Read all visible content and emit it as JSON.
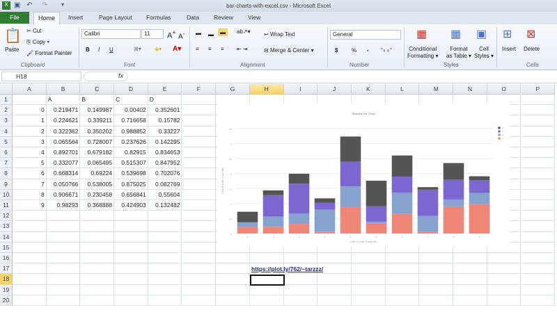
{
  "window": {
    "title": "bar-charts-with-excel.csv - Microsoft Excel"
  },
  "tabs": [
    "File",
    "Home",
    "Insert",
    "Page Layout",
    "Formulas",
    "Data",
    "Review",
    "View"
  ],
  "ribbon": {
    "clipboard": {
      "paste": "Paste",
      "cut": "Cut",
      "copy": "Copy",
      "format_painter": "Format Painter",
      "label": "Clipboard"
    },
    "font": {
      "name": "Calibri",
      "size": "11",
      "label": "Font",
      "bold": "B",
      "italic": "I",
      "underline": "U"
    },
    "alignment": {
      "wrap": "Wrap Text",
      "merge": "Merge & Center",
      "label": "Alignment"
    },
    "number": {
      "format": "General",
      "currency": "$",
      "percent": "%",
      "comma": ",",
      "label": "Number"
    },
    "styles": {
      "conditional": [
        "Conditional",
        "Formatting"
      ],
      "table": [
        "Format",
        "as Table"
      ],
      "cell": [
        "Cell",
        "Styles"
      ],
      "label": "Styles"
    },
    "cells": {
      "insert": "Insert",
      "delete": "Delete",
      "label": "Cells"
    }
  },
  "formula_bar": {
    "name_box": "H18",
    "fx": "fx",
    "value": ""
  },
  "sheet": {
    "columns": [
      "A",
      "B",
      "C",
      "D",
      "E",
      "F",
      "G",
      "H",
      "I",
      "J",
      "K",
      "L",
      "M",
      "N",
      "O",
      "P"
    ],
    "selected_column": "H",
    "selected_row": 18,
    "rows": 20,
    "header_row": [
      "",
      "A",
      "B",
      "C",
      "D"
    ],
    "data": [
      [
        "0",
        "0.219471",
        "0.149987",
        "0.00402",
        "0.352601"
      ],
      [
        "1",
        "0.224621",
        "0.339211",
        "0.716658",
        "0.15782"
      ],
      [
        "2",
        "0.322362",
        "0.350202",
        "0.988852",
        "0.33227"
      ],
      [
        "3",
        "0.065564",
        "0.728007",
        "0.237626",
        "0.142295"
      ],
      [
        "4",
        "0.892701",
        "0.679182",
        "0.82915",
        "0.834653"
      ],
      [
        "5",
        "0.332077",
        "0.065495",
        "0.515307",
        "0.847952"
      ],
      [
        "6",
        "0.668314",
        "0.69224",
        "0.539698",
        "0.702076"
      ],
      [
        "7",
        "0.050766",
        "0.538005",
        "0.875025",
        "0.082769"
      ],
      [
        "8",
        "0.906671",
        "0.230458",
        "0.656841",
        "0.55604"
      ],
      [
        "9",
        "0.98293",
        "0.368888",
        "0.424903",
        "0.132482"
      ]
    ],
    "link": "https://plot.ly/762/~tarzzz/"
  },
  "chart_data": {
    "type": "bar",
    "stacked": true,
    "title": "Stacked Bar Chart",
    "xlabel": "Click to enter X axis title",
    "ylabel": "Click to enter Y axis title",
    "categories": [
      "0",
      "1",
      "2",
      "3",
      "4",
      "5",
      "6",
      "7",
      "8",
      "9"
    ],
    "ylim": [
      0,
      3.5
    ],
    "grid": true,
    "legend": "top-right",
    "series": [
      {
        "name": "A",
        "color": "#ef8677",
        "values": [
          0.219471,
          0.224621,
          0.322362,
          0.065564,
          0.892701,
          0.332077,
          0.668314,
          0.050766,
          0.906671,
          0.98293
        ]
      },
      {
        "name": "B",
        "color": "#86a3cf",
        "values": [
          0.149987,
          0.339211,
          0.350202,
          0.728007,
          0.679182,
          0.065495,
          0.69224,
          0.538005,
          0.230458,
          0.368888
        ]
      },
      {
        "name": "C",
        "color": "#7c67d1",
        "values": [
          0.00402,
          0.716658,
          0.988852,
          0.237626,
          0.82915,
          0.515307,
          0.539698,
          0.875025,
          0.656841,
          0.424903
        ]
      },
      {
        "name": "D",
        "color": "#555555",
        "values": [
          0.352601,
          0.15782,
          0.33227,
          0.142295,
          0.834653,
          0.847952,
          0.702076,
          0.082769,
          0.55604,
          0.132482
        ]
      }
    ]
  }
}
